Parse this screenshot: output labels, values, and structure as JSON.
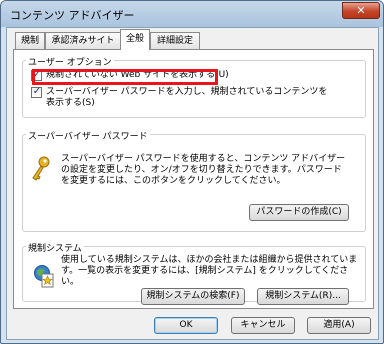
{
  "window": {
    "title": "コンテンツ アドバイザー",
    "close_label": "✕"
  },
  "tabs": [
    {
      "label": "規制"
    },
    {
      "label": "承認済みサイト"
    },
    {
      "label": "全般"
    },
    {
      "label": "詳細設定"
    }
  ],
  "user_options": {
    "title": "ユーザー オプション",
    "option1": {
      "label": "規制されていない Web サイトを表示する(U)",
      "checked": true
    },
    "option2": {
      "label_line1": "スーパーバイザー パスワードを入力し、規制されているコンテンツを",
      "label_line2": "表示する(S)",
      "checked": true
    }
  },
  "supervisor": {
    "title": "スーパーバイザー パスワード",
    "desc_line1": "スーパーバイザー パスワードを使用すると、コンテンツ アドバイザー",
    "desc_line2": "の設定を変更したり、オン/オフを切り替えたりできます。パスワード",
    "desc_line3": "を変更するには、このボタンをクリックしてください。",
    "create_button": "パスワードの作成(C)",
    "icon": "key-icon"
  },
  "rating_system": {
    "title": "規制システム",
    "desc_line1": "使用している規制システムは、ほかの会社または組織から提供されていま",
    "desc_line2": "す。一覧の表示を変更するには、[規制システム] をクリックしてくださ",
    "desc_line3": "い。",
    "find_button": "規制システムの検索(F)",
    "systems_button": "規制システム(R)...",
    "icon": "rating-document-icon"
  },
  "footer": {
    "ok": "OK",
    "cancel": "キャンセル",
    "apply": "適用(A)"
  },
  "colors": {
    "highlight": "#e8151c",
    "titlebar": "#aac3de",
    "close": "#c5452a"
  }
}
